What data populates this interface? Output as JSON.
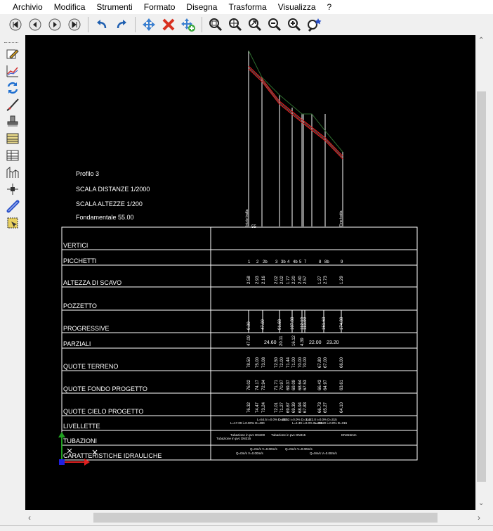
{
  "menu": [
    "Archivio",
    "Modifica",
    "Strumenti",
    "Formato",
    "Disegna",
    "Trasforma",
    "Visualizza",
    "?"
  ],
  "toolbar_icons": [
    "first-page-icon",
    "previous-page-icon",
    "next-page-icon",
    "last-page-icon",
    "undo-icon",
    "redo-icon",
    "pan-icon",
    "delete-icon",
    "add-move-icon",
    "zoom-window-icon",
    "zoom-center-icon",
    "zoom-extents-icon",
    "zoom-out-icon",
    "zoom-in-icon",
    "zoom-realtime-icon"
  ],
  "left_icons": [
    "edit-pencil-icon",
    "profile-chart-icon",
    "refresh-icon",
    "curve-icon",
    "stamp-icon",
    "table-icon",
    "table-grid-icon",
    "section-icon",
    "snap-point-icon",
    "pipe-icon",
    "selection-icon"
  ],
  "profile": {
    "title": "Profilo 3",
    "scale_distances": "SCALA DISTANZE 1/2000",
    "scale_heights": "SCALA ALTEZZE 1/200",
    "datum": "Fondamentale 55.00",
    "start_label": "Inizio tratta",
    "end_label": "Fine tratta",
    "datum_tick": "55"
  },
  "rows": [
    "VERTICI",
    "PICCHETTI",
    "ALTEZZA DI SCAVO",
    "POZZETTO",
    "PROGRESSIVE",
    "PARZIALI",
    "QUOTE TERRENO",
    "QUOTE FONDO PROGETTO",
    "QUOTE CIELO PROGETTO",
    "LIVELLETTE",
    "TUBAZIONI",
    "CARATTERISTICHE IDRAULICHE"
  ],
  "picchetti": [
    "1",
    "2",
    "2b",
    "3",
    "3b",
    "4",
    "4b",
    "5",
    "7",
    "8",
    "8b",
    "9"
  ],
  "altezza_scavo": [
    "2.58",
    "2.93",
    "2.16",
    "2.02",
    "2.02",
    "1.77",
    "2.20",
    "2.40",
    "2.57",
    "1.27",
    "2.73",
    "1.29"
  ],
  "progressive": [
    "0.00",
    "47.09",
    "91.68",
    "107.80",
    "112.19",
    "113.00",
    "151.60",
    "174.80"
  ],
  "parziali": [
    "47.09",
    "24.60",
    "20.11",
    "16.12",
    "4.39",
    "22.00",
    "23.20"
  ],
  "quote_terreno": [
    "78.50",
    "75.00",
    "73.08",
    "72.50",
    "72.00",
    "71.44",
    "71.00",
    "70.00",
    "70.00",
    "67.80",
    "67.00",
    "66.00"
  ],
  "quote_fondo": [
    "76.02",
    "74.17",
    "72.94",
    "71.71",
    "70.97",
    "69.37",
    "69.09",
    "68.64",
    "67.53",
    "66.43",
    "64.97",
    "63.61"
  ],
  "quote_cielo": [
    "76.32",
    "74.47",
    "73.24",
    "72.01",
    "71.27",
    "69.67",
    "69.39",
    "68.94",
    "67.83",
    "66.73",
    "65.27",
    "64.10"
  ],
  "livellette": [
    "L=54.5  i=0.0% D=400",
    "L=17.09  i=0.00% D=400",
    "L=16.12 i=0.0% D=315",
    "L=4.39 i=0.0% D=315",
    "L=22.0 i=0.0% D=315",
    "L=23.20 i=0.0% D=315"
  ],
  "tubazioni": [
    "Tubazione in pvc DN400",
    "Tubazione in pvc DN315",
    "Tubazione in pvc DN315",
    "DN315mm"
  ],
  "idrauliche": [
    "Q=0m/s V=0.00m/s",
    "Q=0m/s V=0.00m/s",
    "Q=0m/s V=0.00m/s",
    "Q=0m/s V=0.00m/s"
  ],
  "colors": {
    "canvas": "#000000",
    "terrain": "#2e6b2e",
    "pipe": "#e02020",
    "axis_x": "#e02020",
    "axis_y": "#20a020",
    "axis_z": "#2020e0"
  }
}
